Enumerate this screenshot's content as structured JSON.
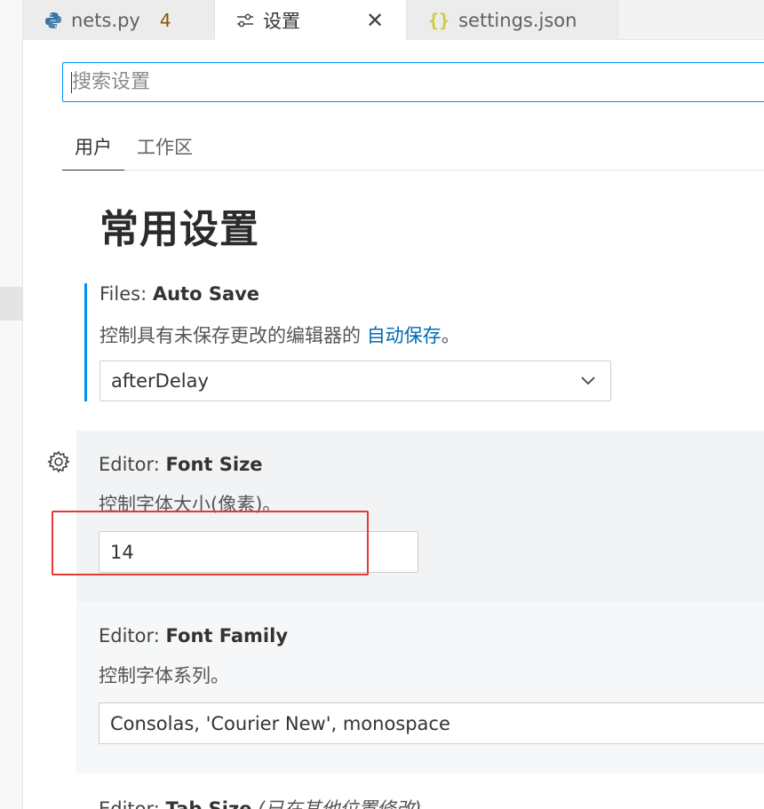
{
  "tabs": [
    {
      "label": "nets.py",
      "badge": "4",
      "icon": "python-icon"
    },
    {
      "label": "设置",
      "icon": "settings-sliders-icon",
      "close": "✕"
    },
    {
      "label": "settings.json",
      "icon": "json-braces-icon"
    }
  ],
  "search": {
    "placeholder": "搜索设置",
    "value": ""
  },
  "scope_tabs": [
    "用户",
    "工作区"
  ],
  "section_title": "常用设置",
  "settings": {
    "auto_save": {
      "category": "Files: ",
      "name": "Auto Save",
      "desc_prefix": "控制具有未保存更改的编辑器的 ",
      "desc_link": "自动保存",
      "desc_suffix": "。",
      "value": "afterDelay"
    },
    "font_size": {
      "category": "Editor: ",
      "name": "Font Size",
      "desc": "控制字体大小(像素)。",
      "value": "14"
    },
    "font_family": {
      "category": "Editor: ",
      "name": "Font Family",
      "desc": "控制字体系列。",
      "value": "Consolas, 'Courier New', monospace"
    },
    "tab_size": {
      "category": "Editor: ",
      "name": "Tab Size",
      "note": "(已在其他位置修改)"
    }
  },
  "colors": {
    "accent": "#0090f1",
    "highlight_box": "#e53935",
    "link": "#006ab1"
  }
}
